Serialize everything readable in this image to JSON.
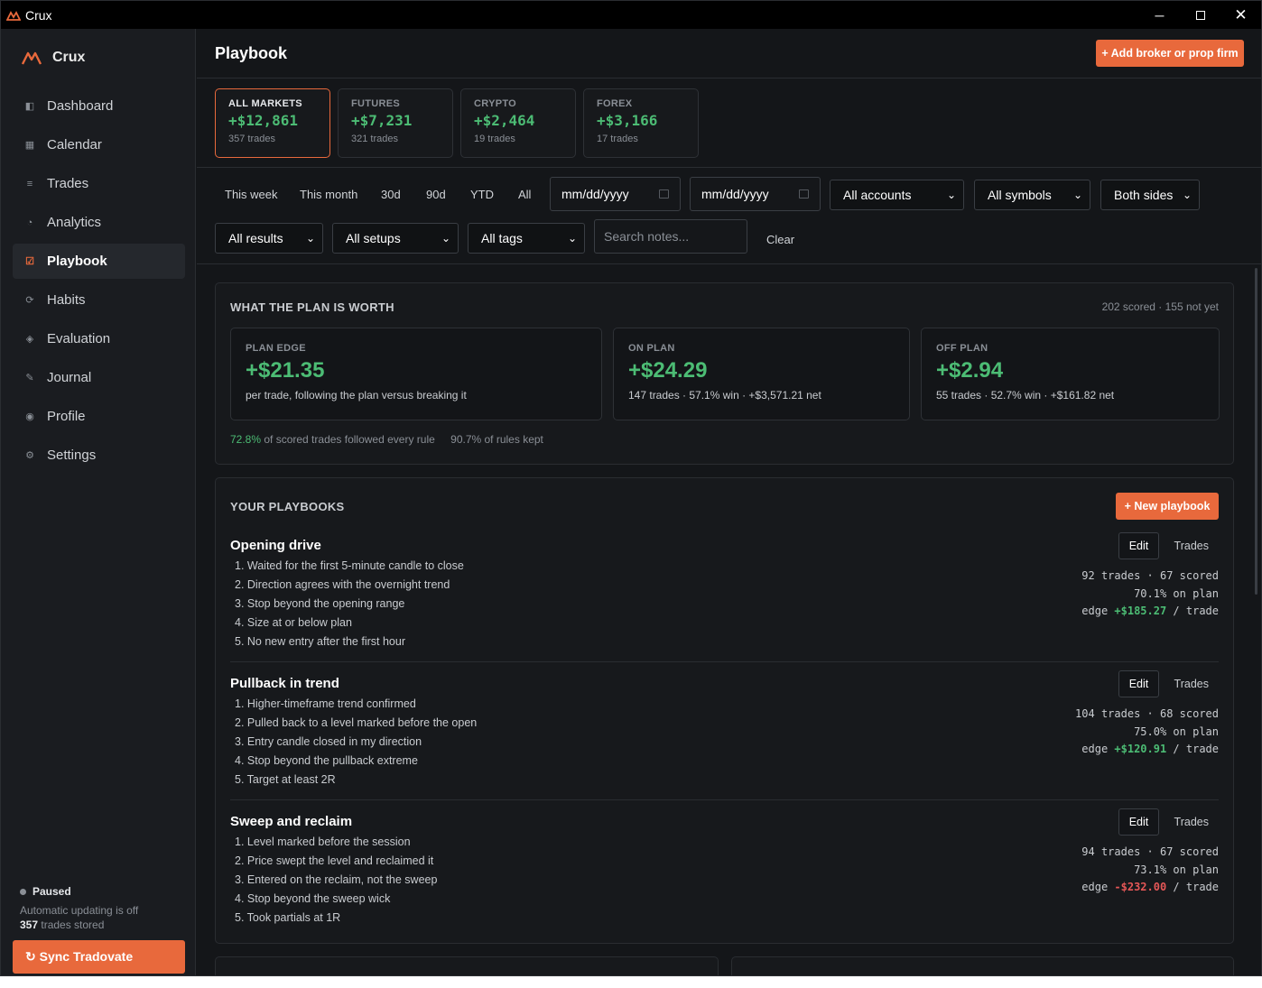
{
  "window": {
    "title": "Crux"
  },
  "sidebar": {
    "brand": "Crux",
    "items": [
      {
        "label": "Dashboard",
        "icon": "◧"
      },
      {
        "label": "Calendar",
        "icon": "▦"
      },
      {
        "label": "Trades",
        "icon": "≡"
      },
      {
        "label": "Analytics",
        "icon": "◔"
      },
      {
        "label": "Playbook",
        "icon": "☑"
      },
      {
        "label": "Habits",
        "icon": "⟳"
      },
      {
        "label": "Evaluation",
        "icon": "◈"
      },
      {
        "label": "Journal",
        "icon": "✎"
      },
      {
        "label": "Profile",
        "icon": "◉"
      },
      {
        "label": "Settings",
        "icon": "⚙"
      }
    ],
    "active": "Playbook",
    "status": {
      "label": "Paused",
      "detail": "Automatic updating is off",
      "count": "357",
      "count_suffix": " trades stored"
    },
    "sync_label": "↻ Sync Tradovate"
  },
  "header": {
    "title": "Playbook",
    "add_label": "+ Add broker or prop firm"
  },
  "markets": [
    {
      "label": "ALL MARKETS",
      "value": "+$12,861",
      "trades": "357 trades"
    },
    {
      "label": "FUTURES",
      "value": "+$7,231",
      "trades": "321 trades"
    },
    {
      "label": "CRYPTO",
      "value": "+$2,464",
      "trades": "19 trades"
    },
    {
      "label": "FOREX",
      "value": "+$3,166",
      "trades": "17 trades"
    }
  ],
  "filters": {
    "ranges": [
      "This week",
      "This month",
      "30d",
      "90d",
      "YTD",
      "All"
    ],
    "date_from": "mm/dd/yyyy",
    "date_to": "mm/dd/yyyy",
    "accounts": "All accounts",
    "symbols": "All symbols",
    "sides": "Both sides",
    "results": "All results",
    "setups": "All setups",
    "tags": "All tags",
    "search_placeholder": "Search notes...",
    "clear": "Clear"
  },
  "worth": {
    "title": "WHAT THE PLAN IS WORTH",
    "scored": "202 scored · 155 not yet",
    "cards": [
      {
        "label": "PLAN EDGE",
        "value": "+$21.35",
        "desc": "per trade, following the plan versus breaking it"
      },
      {
        "label": "ON PLAN",
        "value": "+$24.29",
        "desc": "147 trades · 57.1% win · +$3,571.21 net"
      },
      {
        "label": "OFF PLAN",
        "value": "+$2.94",
        "desc": "55 trades · 52.7% win · +$161.82 net"
      }
    ],
    "followed_pct": "72.8%",
    "followed_text": " of scored trades followed every rule",
    "kept_pct": "90.7%",
    "kept_text": " of rules kept"
  },
  "playbooks": {
    "title": "YOUR PLAYBOOKS",
    "new_label": "+ New playbook",
    "edit_label": "Edit",
    "trades_label": "Trades",
    "items": [
      {
        "name": "Opening drive",
        "rules": [
          "1. Waited for the first 5-minute candle to close",
          "2. Direction agrees with the overnight trend",
          "3. Stop beyond the opening range",
          "4. Size at or below plan",
          "5. No new entry after the first hour"
        ],
        "stats1": "92 trades · 67 scored",
        "stats2": "70.1% on plan",
        "edge": "+$185.27",
        "edge_sign": "pos"
      },
      {
        "name": "Pullback in trend",
        "rules": [
          "1. Higher-timeframe trend confirmed",
          "2. Pulled back to a level marked before the open",
          "3. Entry candle closed in my direction",
          "4. Stop beyond the pullback extreme",
          "5. Target at least 2R"
        ],
        "stats1": "104 trades · 68 scored",
        "stats2": "75.0% on plan",
        "edge": "+$120.91",
        "edge_sign": "pos"
      },
      {
        "name": "Sweep and reclaim",
        "rules": [
          "1. Level marked before the session",
          "2. Price swept the level and reclaimed it",
          "3. Entered on the reclaim, not the sweep",
          "4. Stop beyond the sweep wick",
          "5. Took partials at 1R"
        ],
        "stats1": "94 trades · 67 scored",
        "stats2": "73.1% on plan",
        "edge": "-$232.00",
        "edge_sign": "neg"
      }
    ],
    "edge_prefix": "edge ",
    "edge_suffix": " / trade"
  }
}
